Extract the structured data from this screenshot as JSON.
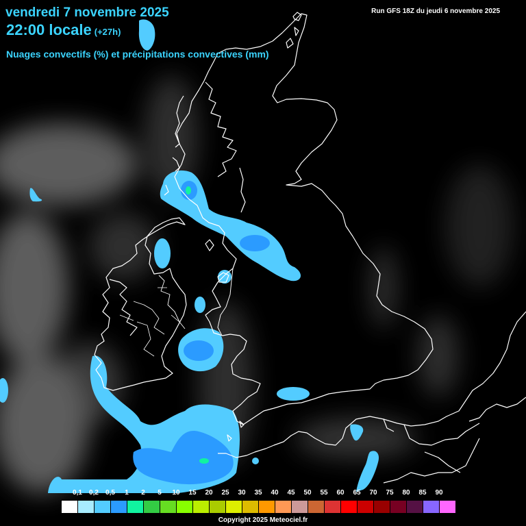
{
  "header": {
    "date": "vendredi 7 novembre 2025",
    "time": "22:00 locale",
    "offset": "(+27h)",
    "subtitle": "Nuages convectifs (%) et précipitations convectives (mm)",
    "run": "Run GFS 18Z du jeudi 6 novembre 2025"
  },
  "legend": {
    "labels": [
      "0,1",
      "0,2",
      "0,5",
      "1",
      "2",
      "5",
      "10",
      "15",
      "20",
      "25",
      "30",
      "35",
      "40",
      "45",
      "50",
      "55",
      "60",
      "65",
      "70",
      "75",
      "80",
      "85",
      "90"
    ],
    "colors": [
      "#ffffff",
      "#a8ecff",
      "#53ccff",
      "#2b9bff",
      "#11f3a0",
      "#33cc44",
      "#66dd22",
      "#88ff00",
      "#bbee00",
      "#aacc00",
      "#ddee00",
      "#ddbb00",
      "#ff9900",
      "#ff9955",
      "#cc9999",
      "#cc6633",
      "#dd3333",
      "#ff0000",
      "#cc0000",
      "#990000",
      "#770022",
      "#551144",
      "#8866ff",
      "#ff66ff"
    ]
  },
  "footer": {
    "copyright": "Copyright 2025 Meteociel.fr"
  },
  "map_colors": {
    "cloud": "#8a8a8a",
    "precip_light": "#53ccff",
    "precip_mid": "#2b9bff",
    "precip_heavy": "#11f3a0",
    "coast": "#ffffff"
  }
}
